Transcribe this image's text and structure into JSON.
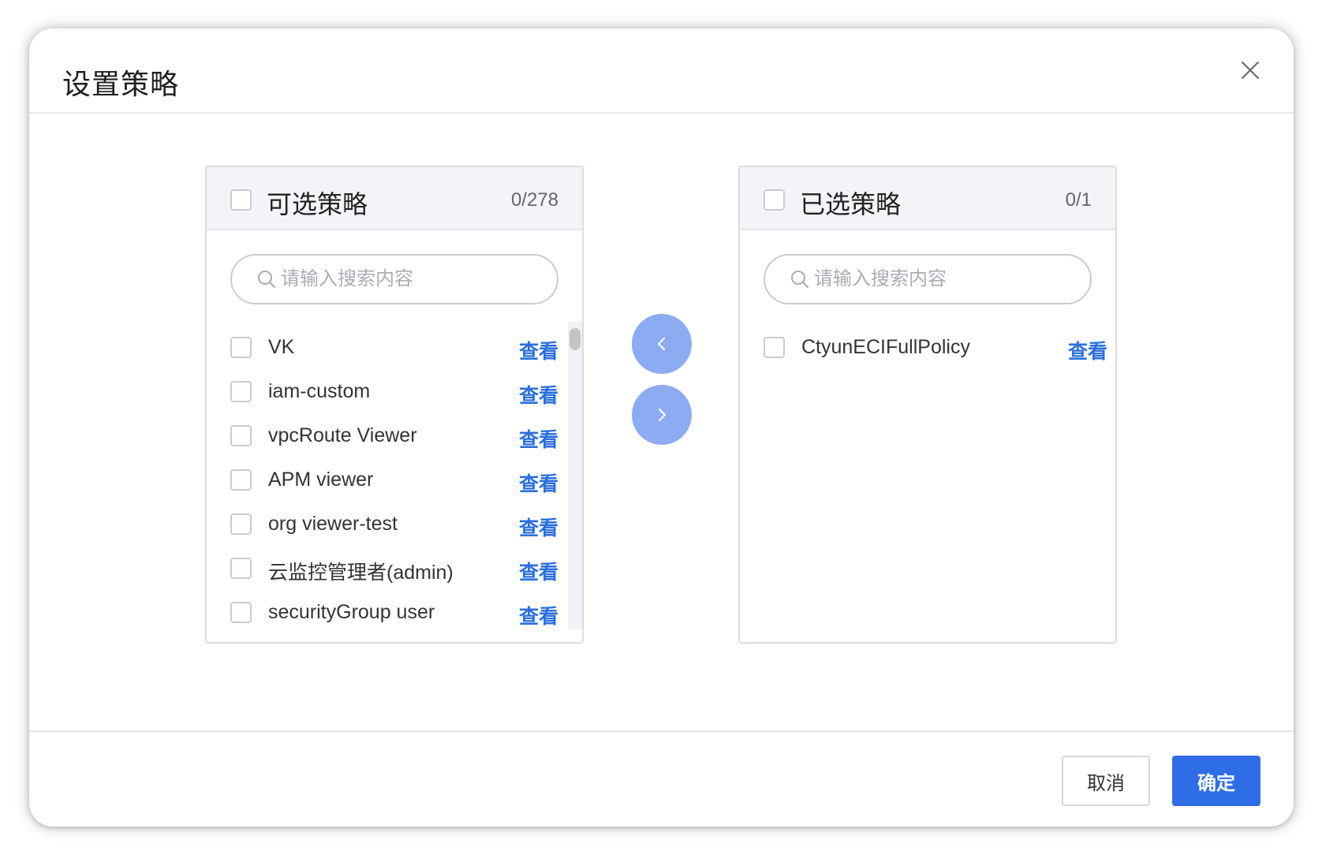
{
  "dialog": {
    "title": "设置策略",
    "close_icon": "close-icon"
  },
  "left_panel": {
    "title": "可选策略",
    "count": "0/278",
    "search_placeholder": "请输入搜索内容",
    "items": [
      {
        "label": "VK",
        "action": "查看"
      },
      {
        "label": "iam-custom",
        "action": "查看"
      },
      {
        "label": "vpcRoute Viewer",
        "action": "查看"
      },
      {
        "label": "APM viewer",
        "action": "查看"
      },
      {
        "label": "org viewer-test",
        "action": "查看"
      },
      {
        "label": "云监控管理者(admin)",
        "action": "查看"
      },
      {
        "label": "securityGroup user",
        "action": "查看"
      }
    ]
  },
  "right_panel": {
    "title": "已选策略",
    "count": "0/1",
    "search_placeholder": "请输入搜索内容",
    "items": [
      {
        "label": "CtyunECIFullPolicy",
        "action": "查看"
      }
    ]
  },
  "transfer": {
    "move_left_icon": "chevron-left-icon",
    "move_right_icon": "chevron-right-icon"
  },
  "footer": {
    "cancel_label": "取消",
    "ok_label": "确定"
  },
  "colors": {
    "primary": "#2f6de6",
    "link": "#2b6fdc",
    "transfer_button": "#8cabf2",
    "panel_header_bg": "#f2f4f7"
  }
}
